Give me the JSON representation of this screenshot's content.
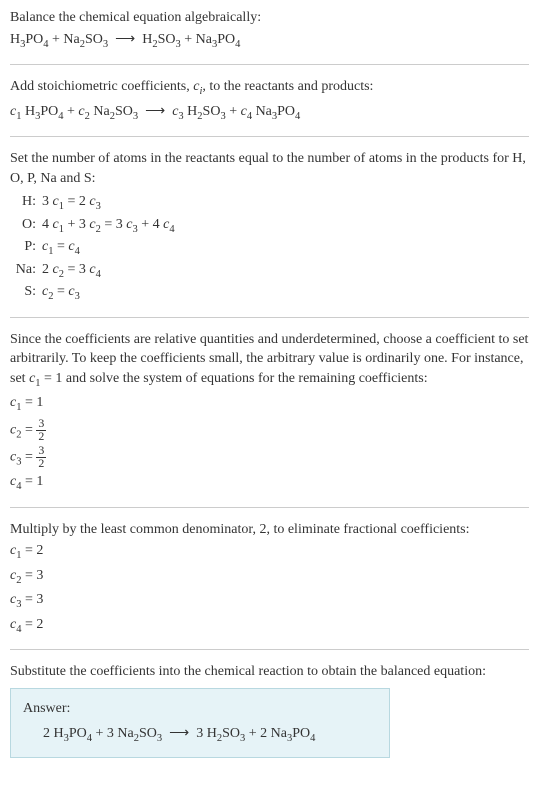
{
  "intro": {
    "line1": "Balance the chemical equation algebraically:",
    "reaction_html": "H<sub>3</sub>PO<sub>4</sub> + Na<sub>2</sub>SO<sub>3</sub> &nbsp;⟶&nbsp; H<sub>2</sub>SO<sub>3</sub> + Na<sub>3</sub>PO<sub>4</sub>"
  },
  "stoich": {
    "line1_html": "Add stoichiometric coefficients, <span class=\"italic\">c<sub>i</sub></span>, to the reactants and products:",
    "reaction_html": "<span class=\"italic\">c</span><sub>1</sub> H<sub>3</sub>PO<sub>4</sub> + <span class=\"italic\">c</span><sub>2</sub> Na<sub>2</sub>SO<sub>3</sub> &nbsp;⟶&nbsp; <span class=\"italic\">c</span><sub>3</sub> H<sub>2</sub>SO<sub>3</sub> + <span class=\"italic\">c</span><sub>4</sub> Na<sub>3</sub>PO<sub>4</sub>"
  },
  "atoms": {
    "intro": "Set the number of atoms in the reactants equal to the number of atoms in the products for H, O, P, Na and S:",
    "rows": [
      {
        "label": "H:",
        "eq_html": "3 <span class=\"italic\">c</span><sub>1</sub> = 2 <span class=\"italic\">c</span><sub>3</sub>"
      },
      {
        "label": "O:",
        "eq_html": "4 <span class=\"italic\">c</span><sub>1</sub> + 3 <span class=\"italic\">c</span><sub>2</sub> = 3 <span class=\"italic\">c</span><sub>3</sub> + 4 <span class=\"italic\">c</span><sub>4</sub>"
      },
      {
        "label": "P:",
        "eq_html": "<span class=\"italic\">c</span><sub>1</sub> = <span class=\"italic\">c</span><sub>4</sub>"
      },
      {
        "label": "Na:",
        "eq_html": "2 <span class=\"italic\">c</span><sub>2</sub> = 3 <span class=\"italic\">c</span><sub>4</sub>"
      },
      {
        "label": "S:",
        "eq_html": "<span class=\"italic\">c</span><sub>2</sub> = <span class=\"italic\">c</span><sub>3</sub>"
      }
    ]
  },
  "solve1": {
    "intro_html": "Since the coefficients are relative quantities and underdetermined, choose a coefficient to set arbitrarily. To keep the coefficients small, the arbitrary value is ordinarily one. For instance, set <span class=\"italic\">c</span><sub>1</sub> = 1 and solve the system of equations for the remaining coefficients:",
    "rows": [
      {
        "html": "<span class=\"italic\">c</span><sub>1</sub> = 1"
      },
      {
        "html": "<span class=\"italic\">c</span><sub>2</sub> = <span class=\"frac\"><span class=\"num\">3</span><span class=\"den\">2</span></span>"
      },
      {
        "html": "<span class=\"italic\">c</span><sub>3</sub> = <span class=\"frac\"><span class=\"num\">3</span><span class=\"den\">2</span></span>"
      },
      {
        "html": "<span class=\"italic\">c</span><sub>4</sub> = 1"
      }
    ]
  },
  "solve2": {
    "intro": "Multiply by the least common denominator, 2, to eliminate fractional coefficients:",
    "rows": [
      {
        "html": "<span class=\"italic\">c</span><sub>1</sub> = 2"
      },
      {
        "html": "<span class=\"italic\">c</span><sub>2</sub> = 3"
      },
      {
        "html": "<span class=\"italic\">c</span><sub>3</sub> = 3"
      },
      {
        "html": "<span class=\"italic\">c</span><sub>4</sub> = 2"
      }
    ]
  },
  "final": {
    "intro": "Substitute the coefficients into the chemical reaction to obtain the balanced equation:",
    "answer_label": "Answer:",
    "answer_html": "2 H<sub>3</sub>PO<sub>4</sub> + 3 Na<sub>2</sub>SO<sub>3</sub> &nbsp;⟶&nbsp; 3 H<sub>2</sub>SO<sub>3</sub> + 2 Na<sub>3</sub>PO<sub>4</sub>"
  }
}
